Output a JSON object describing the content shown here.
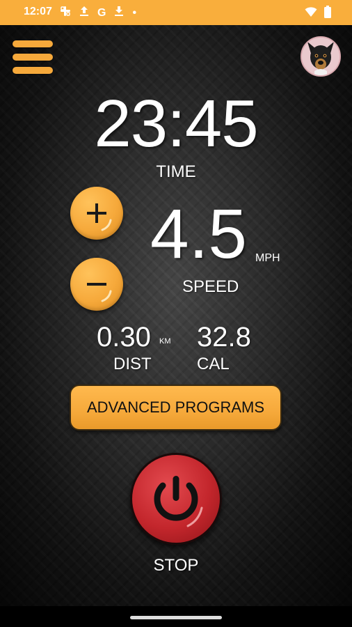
{
  "status_bar": {
    "time": "12:07",
    "left_icons": [
      "slack-icon",
      "upload-icon",
      "google-icon",
      "download-icon",
      "dot-icon"
    ],
    "right_icons": [
      "wifi-icon",
      "battery-icon"
    ],
    "google_glyph": "G",
    "dot_glyph": "•"
  },
  "header": {
    "menu_icon": "hamburger-menu-icon",
    "avatar_icon": "dog-avatar"
  },
  "workout": {
    "time_value": "23:45",
    "time_label": "TIME",
    "speed_value": "4.5",
    "speed_unit": "MPH",
    "speed_label": "SPEED",
    "distance_value": "0.30",
    "distance_unit": "KM",
    "distance_label": "DIST",
    "calories_value": "32.8",
    "calories_label": "CAL"
  },
  "controls": {
    "advanced_programs_label": "ADVANCED PROGRAMS",
    "stop_label": "STOP",
    "plus_icon": "plus-icon",
    "minus_icon": "minus-icon",
    "power_icon": "power-icon"
  },
  "colors": {
    "accent": "#F6A93B",
    "status_bar": "#F9AE3C",
    "stop": "#C3262C",
    "text": "#FFFFFF"
  }
}
